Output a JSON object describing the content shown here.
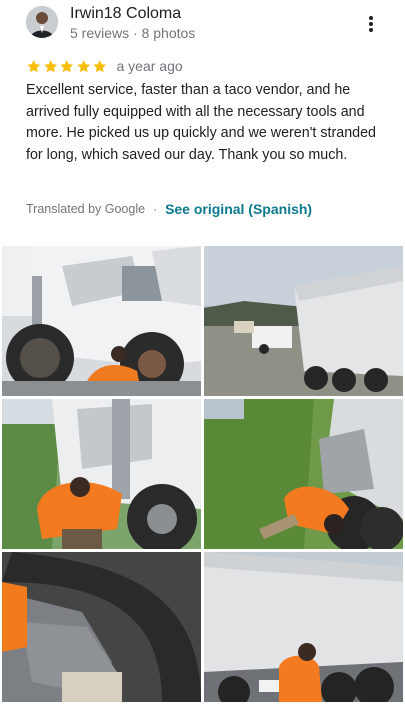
{
  "review": {
    "reviewer_name": "Irwin18 Coloma",
    "reviewer_meta": "5 reviews · 8 photos",
    "rating": 5,
    "date": "a year ago",
    "text": "Excellent service, faster than a taco vendor, and he arrived fully equipped with all the necessary tools and more. He picked us up quickly and we weren't stranded for long, which saved our day. Thank you so much.",
    "translated_label": "Translated by Google",
    "separator": "·",
    "see_original_label": "See original (Spanish)"
  },
  "icons": {
    "more": "more-vert-icon",
    "star": "star-icon"
  },
  "colors": {
    "star": "#fbbc04",
    "link": "#0b7a8f",
    "meta_text": "#70757a"
  },
  "photos": [
    {
      "name": "photo-truck-wheel-removed"
    },
    {
      "name": "photo-dump-truck-roadside"
    },
    {
      "name": "photo-mechanic-at-wheel"
    },
    {
      "name": "photo-mechanic-under-truck"
    },
    {
      "name": "photo-glove-on-tire"
    },
    {
      "name": "photo-mechanic-beside-dump-truck"
    }
  ]
}
